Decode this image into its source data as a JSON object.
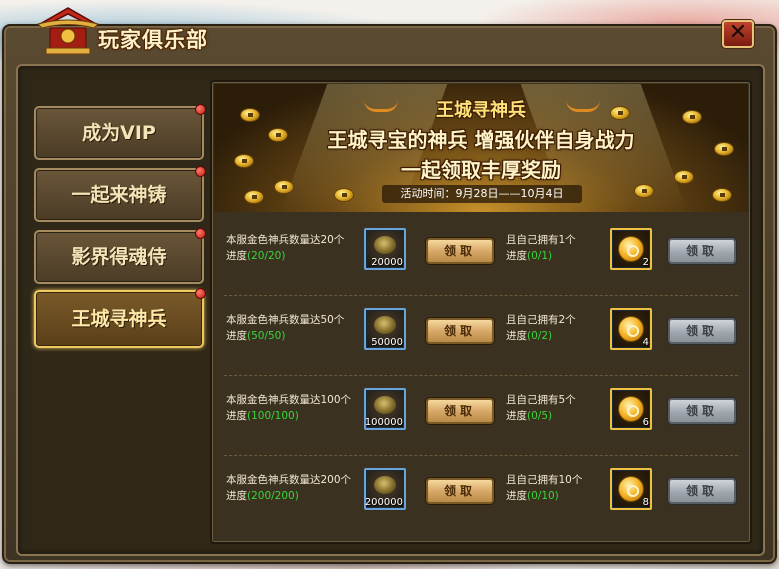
{
  "window": {
    "title": "玩家俱乐部"
  },
  "tabs": [
    {
      "label": "成为VIP",
      "active": false,
      "has_dot": true
    },
    {
      "label": "一起来神铸",
      "active": false,
      "has_dot": true
    },
    {
      "label": "影界得魂侍",
      "active": false,
      "has_dot": true
    },
    {
      "label": "王城寻神兵",
      "active": true,
      "has_dot": true
    }
  ],
  "banner": {
    "title": "王城寻神兵",
    "line1": "王城寻宝的神兵 增强伙伴自身战力",
    "line2": "一起领取丰厚奖励",
    "time": "活动时间：9月28日——10月4日"
  },
  "rows": [
    {
      "left_text": "本服金色神兵数量达20个",
      "left_progress_label": "进度",
      "left_progress": "(20/20)",
      "left_reward_count": "20000",
      "left_button": "领取",
      "right_text": "且自己拥有1个",
      "right_progress_label": "进度",
      "right_progress": "(0/1)",
      "right_reward_count": "2",
      "right_button": "领取"
    },
    {
      "left_text": "本服金色神兵数量达50个",
      "left_progress_label": "进度",
      "left_progress": "(50/50)",
      "left_reward_count": "50000",
      "left_button": "领取",
      "right_text": "且自己拥有2个",
      "right_progress_label": "进度",
      "right_progress": "(0/2)",
      "right_reward_count": "4",
      "right_button": "领取"
    },
    {
      "left_text": "本服金色神兵数量达100个",
      "left_progress_label": "进度",
      "left_progress": "(100/100)",
      "left_reward_count": "100000",
      "left_button": "领取",
      "right_text": "且自己拥有5个",
      "right_progress_label": "进度",
      "right_progress": "(0/5)",
      "right_reward_count": "6",
      "right_button": "领取"
    },
    {
      "left_text": "本服金色神兵数量达200个",
      "left_progress_label": "进度",
      "left_progress": "(200/200)",
      "left_reward_count": "200000",
      "left_button": "领取",
      "right_text": "且自己拥有10个",
      "right_progress_label": "进度",
      "right_progress": "(0/10)",
      "right_reward_count": "8",
      "right_button": "领取"
    }
  ],
  "colors": {
    "progress_text": "#38d638",
    "active_tab_border": "#f0c860",
    "notify_dot": "#c01a10"
  },
  "icons": {
    "close": "close-icon",
    "logo": "palace-logo-icon",
    "left_reward": "silver-coin-pile-icon",
    "right_reward": "gold-token-icon"
  }
}
